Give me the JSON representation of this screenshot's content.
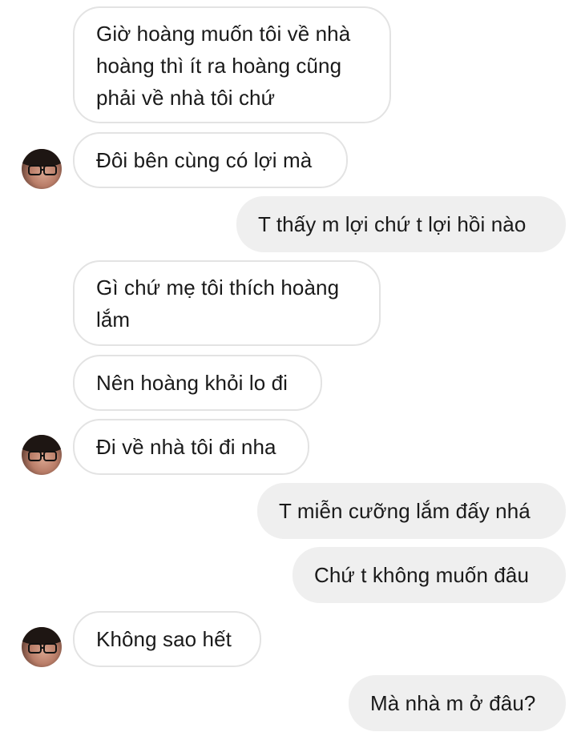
{
  "conversation": {
    "messages": [
      {
        "sender": "other",
        "text": "Giờ hoàng muốn tôi về nhà\nhoàng thì ít ra hoàng cũng\nphải về nhà tôi chứ"
      },
      {
        "sender": "other",
        "text": "Đôi bên cùng có lợi mà",
        "avatar": "user-avatar"
      },
      {
        "sender": "me",
        "text": "T thấy m lợi chứ t lợi hồi nào"
      },
      {
        "sender": "other",
        "text": "Gì chứ mẹ tôi thích hoàng\nlắm"
      },
      {
        "sender": "other",
        "text": "Nên hoàng khỏi lo đi"
      },
      {
        "sender": "other",
        "text": "Đi về nhà tôi đi nha",
        "avatar": "user-avatar"
      },
      {
        "sender": "me",
        "text": "T miễn cưỡng lắm đấy nhá"
      },
      {
        "sender": "me",
        "text": "Chứ t không muốn đâu"
      },
      {
        "sender": "other",
        "text": "Không sao hết",
        "avatar": "user-avatar"
      },
      {
        "sender": "me",
        "text": "Mà nhà m ở đâu?"
      }
    ]
  },
  "colors": {
    "incoming_bubble_bg": "#ffffff",
    "incoming_bubble_border": "#e3e3e3",
    "outgoing_bubble_bg": "#efefef",
    "text": "#1a1a1a"
  }
}
